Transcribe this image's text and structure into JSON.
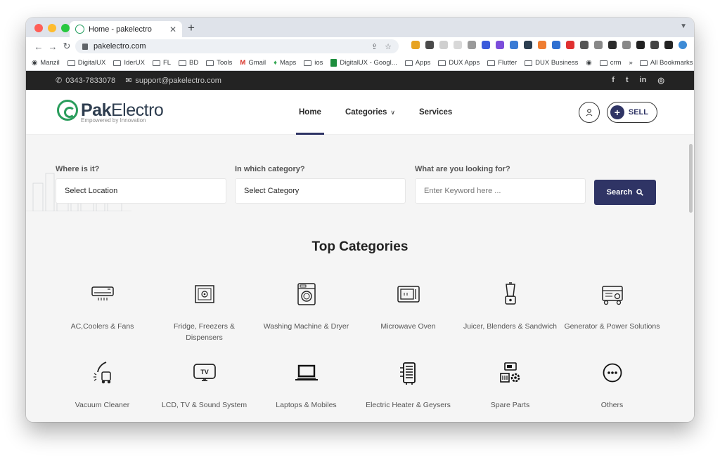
{
  "browser": {
    "tab_title": "Home - pakelectro",
    "new_tab": "+",
    "url": "pakelectro.com",
    "bookmarks": [
      "Manzil",
      "DigitalUX",
      "IderUX",
      "FL",
      "BD",
      "Tools",
      "Gmail",
      "Maps",
      "ios",
      "DigitalUX - Googl...",
      "Apps",
      "DUX Apps",
      "Flutter",
      "DUX Business",
      "crm"
    ],
    "more": "»",
    "all_bookmarks": "All Bookmarks"
  },
  "topbar": {
    "phone": "0343-7833078",
    "email": "support@pakelectro.com",
    "social_icons": [
      "facebook-icon",
      "twitter-icon",
      "linkedin-icon",
      "instagram-icon"
    ]
  },
  "header": {
    "logo_bold": "Pak",
    "logo_light": "Electro",
    "tagline": "Empowered by Innovation",
    "nav": [
      "Home",
      "Categories",
      "Services"
    ],
    "sell_label": "SELL"
  },
  "search": {
    "location_label": "Where is it?",
    "location_value": "Select Location",
    "category_label": "In which category?",
    "category_value": "Select Category",
    "keyword_label": "What are you looking for?",
    "keyword_placeholder": "Enter Keyword here ...",
    "button_label": "Search"
  },
  "categories": {
    "title": "Top Categories",
    "items": [
      {
        "label": "AC,Coolers & Fans",
        "icon": "air-conditioner-icon"
      },
      {
        "label": "Fridge, Freezers & Dispensers",
        "icon": "fridge-icon"
      },
      {
        "label": "Washing Machine & Dryer",
        "icon": "washing-machine-icon"
      },
      {
        "label": "Microwave Oven",
        "icon": "microwave-icon"
      },
      {
        "label": "Juicer, Blenders & Sandwich",
        "icon": "blender-icon"
      },
      {
        "label": "Generator & Power Solutions",
        "icon": "generator-icon"
      },
      {
        "label": "Vacuum Cleaner",
        "icon": "vacuum-icon"
      },
      {
        "label": "LCD, TV & Sound System",
        "icon": "tv-icon"
      },
      {
        "label": "Laptops & Mobiles",
        "icon": "laptop-icon"
      },
      {
        "label": "Electric Heater & Geysers",
        "icon": "heater-icon"
      },
      {
        "label": "Spare Parts",
        "icon": "spare-parts-icon"
      },
      {
        "label": "Others",
        "icon": "more-icon"
      }
    ]
  },
  "colors": {
    "primary": "#2f3465",
    "brand_green": "#2a9d5c",
    "topbar": "#232323"
  }
}
